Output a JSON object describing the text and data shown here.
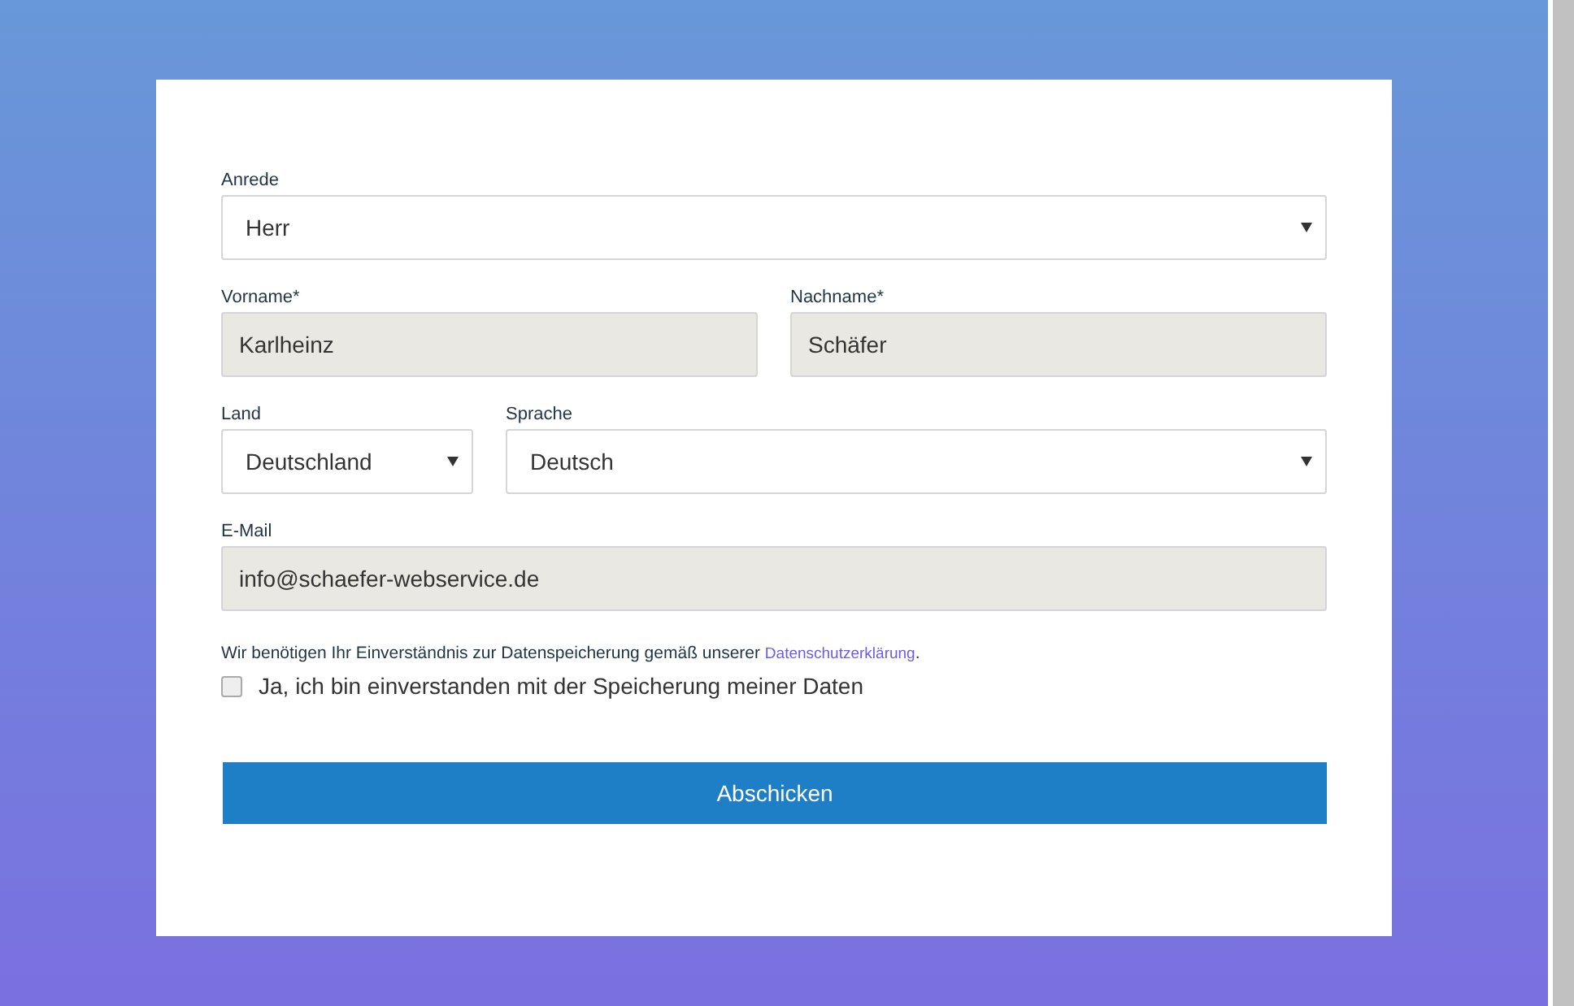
{
  "form": {
    "rows": [
      [
        {
          "label": "Anrede",
          "kind": "select",
          "value": "Herr"
        }
      ],
      [
        {
          "label": "Vorname*",
          "kind": "input",
          "value": "Karlheinz"
        },
        {
          "label": "Nachname*",
          "kind": "input",
          "value": "Schäfer"
        }
      ],
      [
        {
          "label": "Land",
          "kind": "select",
          "value": "Deutschland"
        },
        {
          "label": "Sprache",
          "kind": "select",
          "value": "Deutsch"
        }
      ],
      [
        {
          "label": "E-Mail",
          "kind": "input",
          "value": "info@schaefer-webservice.de"
        }
      ]
    ],
    "consent": {
      "text": "Wir benötigen Ihr Einverständnis zur Datenspeicherung gemäß unserer",
      "link": "Datenschutzerklärung",
      "after": "."
    },
    "checkbox": {
      "label": "Ja, ich bin einverstanden mit der Speicherung meiner Daten",
      "checked": false
    },
    "submit": "Abschicken"
  }
}
